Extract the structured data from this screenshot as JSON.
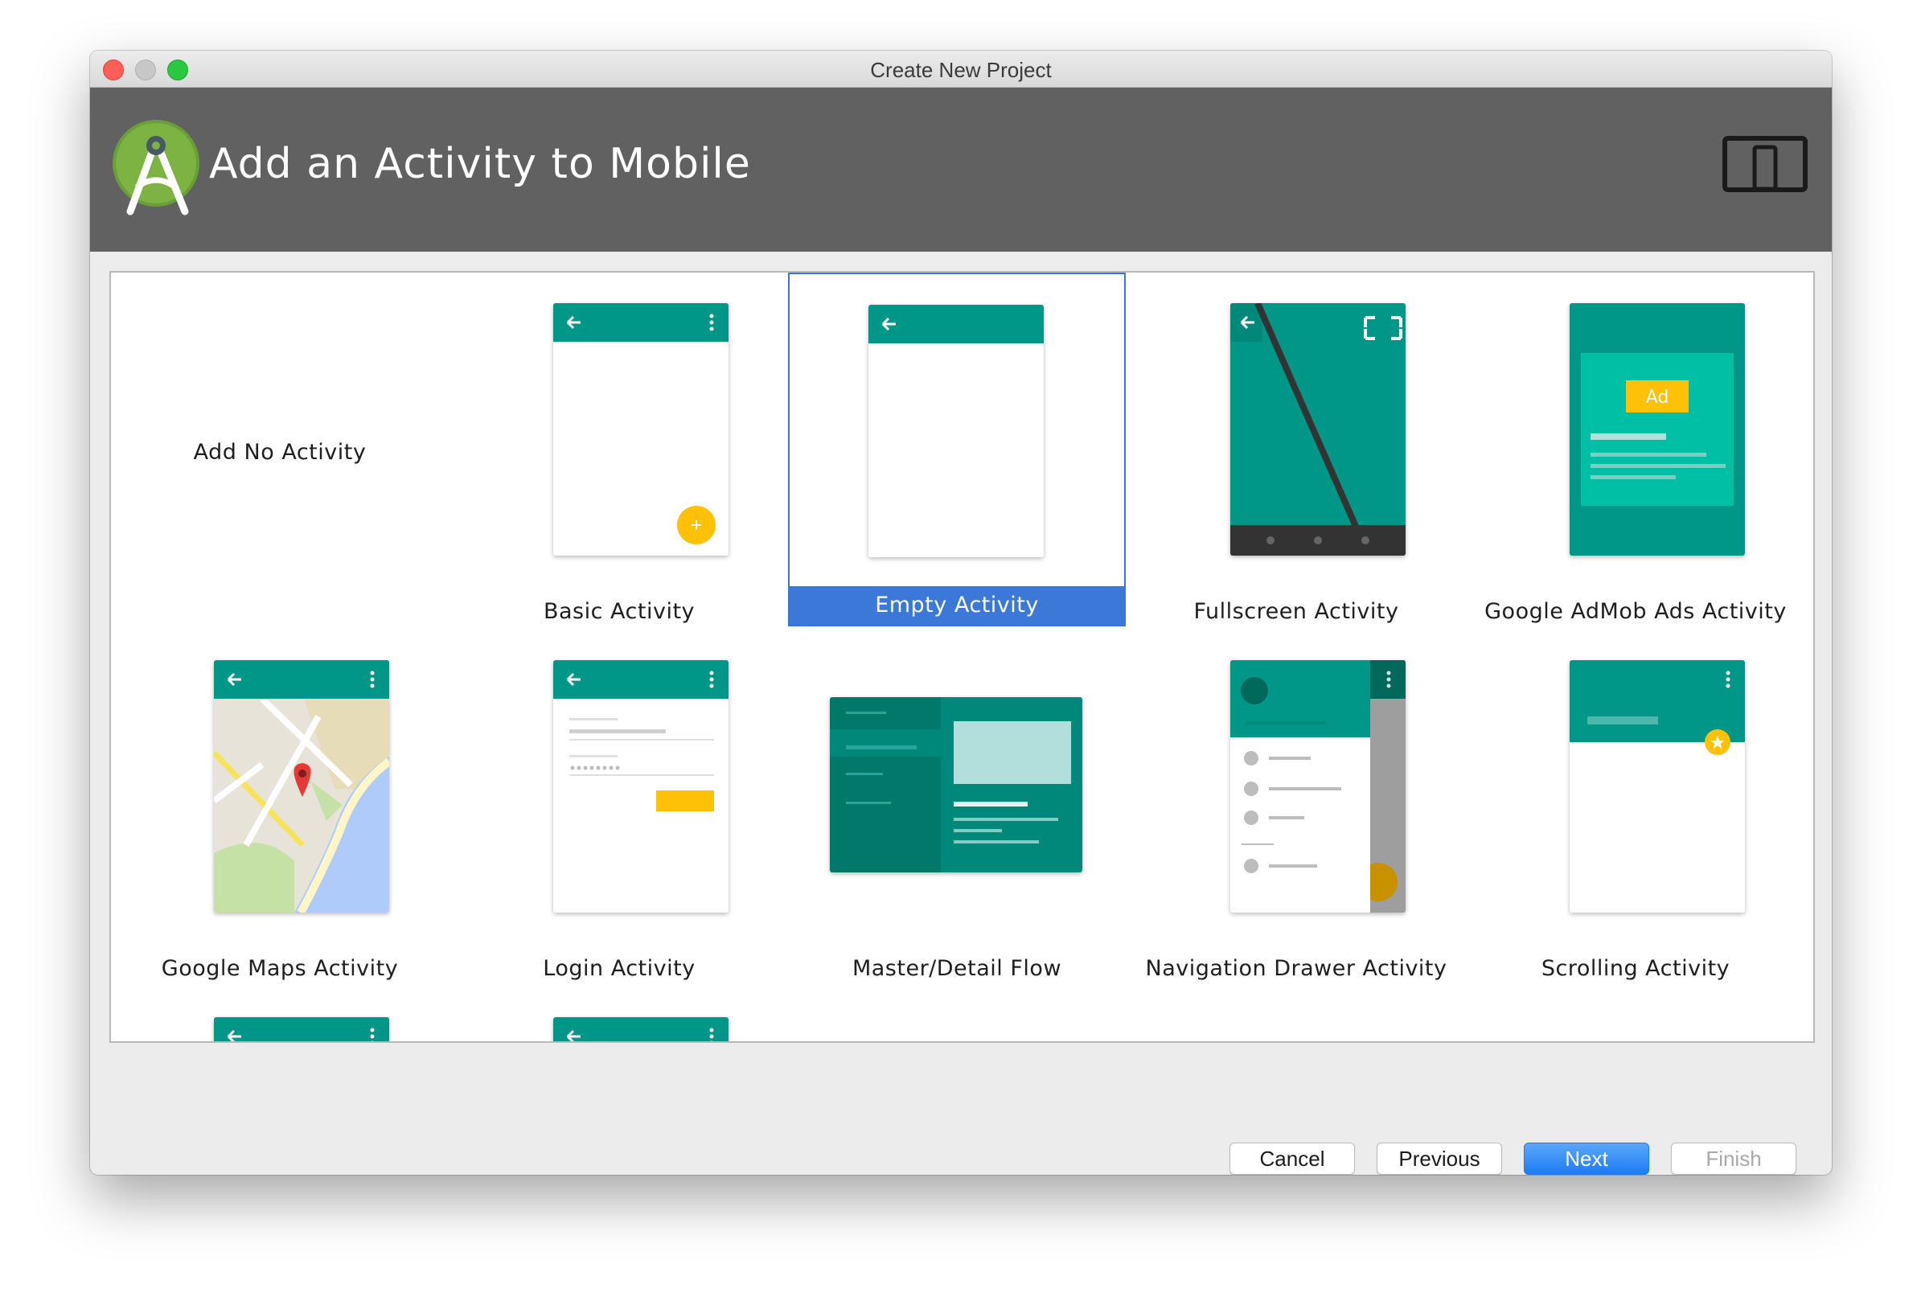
{
  "window": {
    "title": "Create New Project"
  },
  "header": {
    "title": "Add an Activity to Mobile",
    "logo_icon": "android-studio-logo-icon",
    "device_icon": "phone-tablet-icon"
  },
  "colors": {
    "teal": "#009688",
    "teal_light": "#00bfa5",
    "accent": "#ffc107",
    "selection": "#3b78d8",
    "header_bg": "#616161"
  },
  "gallery": {
    "tiles": [
      {
        "label": "Add No Activity"
      },
      {
        "label": "Basic Activity"
      },
      {
        "label": "Empty Activity",
        "selected": true
      },
      {
        "label": "Fullscreen Activity"
      },
      {
        "label": "Google AdMob Ads Activity",
        "ad_badge": "Ad"
      },
      {
        "label": "Google Maps Activity"
      },
      {
        "label": "Login Activity"
      },
      {
        "label": "Master/Detail Flow"
      },
      {
        "label": "Navigation Drawer Activity"
      },
      {
        "label": "Scrolling Activity"
      }
    ]
  },
  "footer": {
    "cancel": "Cancel",
    "previous": "Previous",
    "next": "Next",
    "finish": "Finish"
  }
}
